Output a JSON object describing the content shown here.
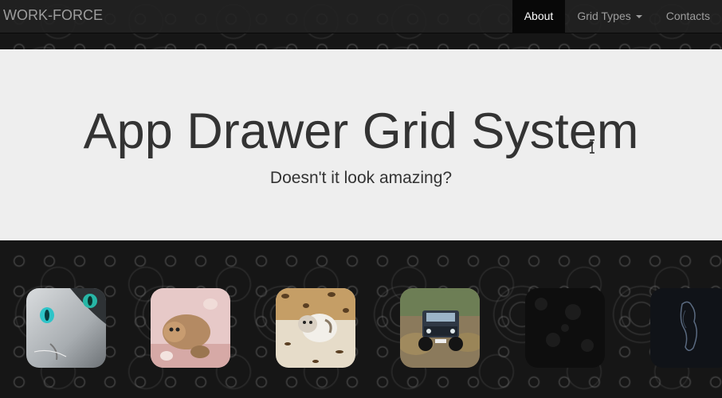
{
  "navbar": {
    "brand": "WORK-FORCE",
    "items": [
      {
        "label": "About",
        "active": true
      },
      {
        "label": "Grid Types",
        "dropdown": true
      },
      {
        "label": "Contacts"
      }
    ]
  },
  "jumbotron": {
    "title": "App Drawer Grid System",
    "subtitle": "Doesn't it look amazing?"
  },
  "apps": [
    {
      "icon": "cat-blue-eyes-icon"
    },
    {
      "icon": "kitten-playing-icon"
    },
    {
      "icon": "kitten-leopard-blanket-icon"
    },
    {
      "icon": "jeep-offroad-icon"
    },
    {
      "icon": "dark-texture-icon"
    },
    {
      "icon": "dark-horse-icon"
    }
  ],
  "colors": {
    "navbar_bg": "#222222",
    "nav_active_bg": "#080808",
    "jumbotron_bg": "#eeeeee",
    "text": "#333333"
  }
}
